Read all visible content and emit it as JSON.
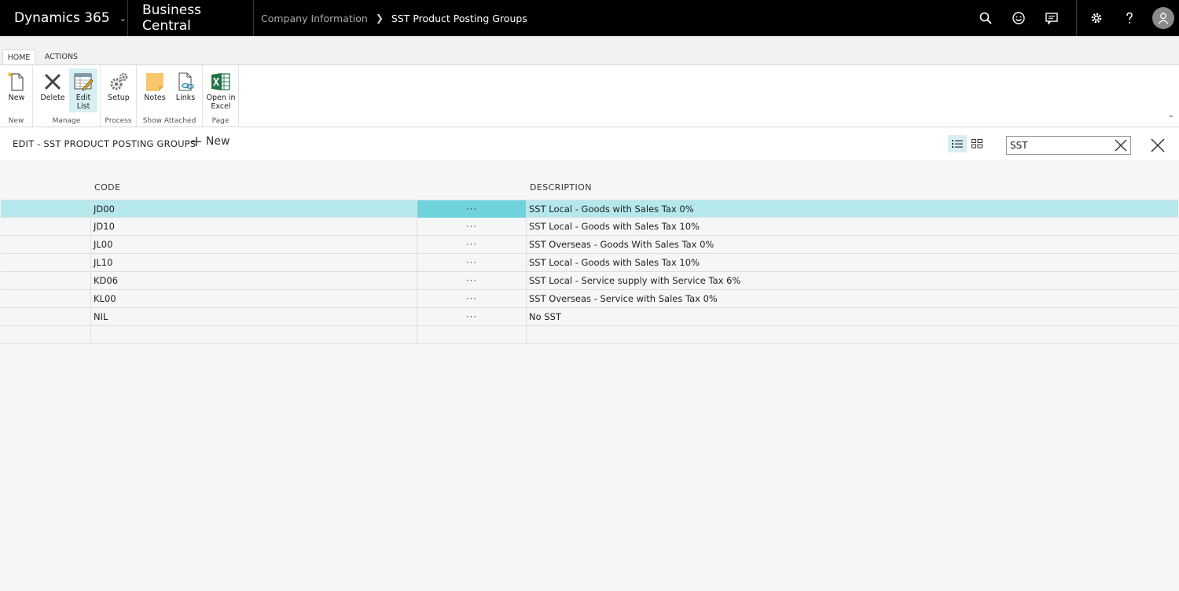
{
  "topbar": {
    "product": "Dynamics 365",
    "app": "Business Central",
    "breadcrumb": {
      "parent": "Company Information",
      "current": "SST Product Posting Groups"
    },
    "icons": [
      "search-icon",
      "smiley-icon",
      "chat-icon",
      "gear-icon",
      "help-icon",
      "user-icon"
    ]
  },
  "ribbon": {
    "tabs": [
      "HOME",
      "ACTIONS"
    ],
    "groups": {
      "new": {
        "label": "New",
        "buttons": {
          "new": "New"
        }
      },
      "manage": {
        "label": "Manage",
        "buttons": {
          "delete": "Delete",
          "edit_list_1": "Edit",
          "edit_list_2": "List"
        }
      },
      "process": {
        "label": "Process",
        "buttons": {
          "setup": "Setup"
        }
      },
      "show_attached": {
        "label": "Show Attached",
        "buttons": {
          "notes": "Notes",
          "links": "Links"
        }
      },
      "page": {
        "label": "Page",
        "buttons": {
          "excel_1": "Open in",
          "excel_2": "Excel"
        }
      }
    }
  },
  "page": {
    "title": "EDIT - SST PRODUCT POSTING GROUPS",
    "new_label": "New",
    "search_value": "SST"
  },
  "grid": {
    "columns": {
      "code": "CODE",
      "description": "DESCRIPTION"
    },
    "selected_row": 0,
    "row_menu": "···",
    "rows": [
      {
        "code": "JD00",
        "description": "SST Local - Goods with Sales Tax 0%"
      },
      {
        "code": "JD10",
        "description": "SST Local - Goods with Sales Tax 10%"
      },
      {
        "code": "JL00",
        "description": "SST Overseas - Goods With Sales Tax 0%"
      },
      {
        "code": "JL10",
        "description": "SST Local - Goods with Sales Tax 10%"
      },
      {
        "code": "KD06",
        "description": "SST Local - Service supply with Service Tax 6%"
      },
      {
        "code": "KL00",
        "description": "SST Overseas - Service with Sales Tax 0%"
      },
      {
        "code": "NIL",
        "description": "No SST"
      },
      {
        "code": "",
        "description": ""
      }
    ]
  },
  "colors": {
    "topbar_bg": "#000000",
    "selected_row": "#b5e8ed",
    "selected_menu_cell": "#6fd3dd",
    "active_toggle": "#d7eef2",
    "excel_green": "#217346"
  }
}
